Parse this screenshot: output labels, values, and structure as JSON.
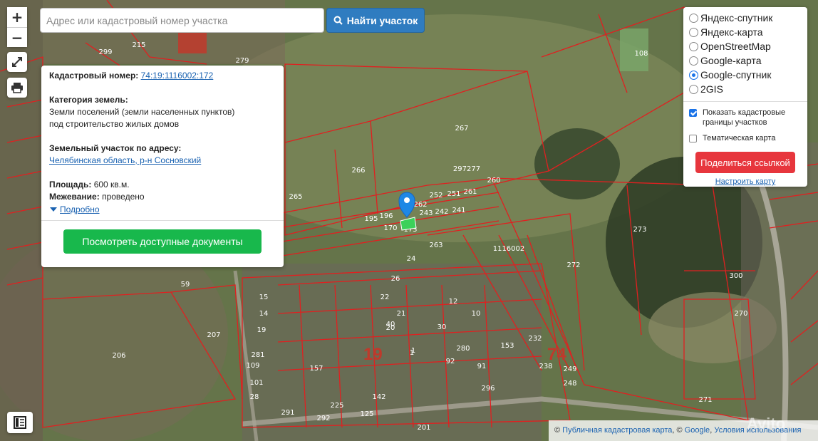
{
  "map": {
    "parcel_labels": [
      "299",
      "279",
      "215",
      "108",
      "267",
      "266",
      "265",
      "297277",
      "260",
      "261",
      "262",
      "252",
      "251",
      "196",
      "195",
      "170",
      "173",
      "243",
      "242",
      "241",
      "263",
      "1116002",
      "272",
      "273",
      "300",
      "270",
      "271",
      "59",
      "15",
      "14",
      "19",
      "1",
      "24",
      "26",
      "22",
      "21",
      "20",
      "12",
      "10",
      "30",
      "40",
      "280",
      "153",
      "91",
      "92",
      "232",
      "248",
      "249",
      "238",
      "296",
      "207",
      "206",
      "101",
      "28",
      "281",
      "109",
      "291",
      "292",
      "225",
      "142",
      "125",
      "157",
      "201",
      "1"
    ],
    "big_labels": [
      "19",
      "74"
    ]
  },
  "zoom": {
    "plus": "+",
    "minus": "−"
  },
  "controls": {
    "fullscreen_icon": "expand-arrows-icon",
    "print_icon": "printer-icon",
    "legend_icon": "map-legend-icon"
  },
  "search": {
    "placeholder": "Адрес или кадастровый номер участка",
    "value": "",
    "button_label": "Найти участок",
    "button_icon": "search-icon"
  },
  "info": {
    "cadastral_label": "Кадастровый номер:",
    "cadastral_number": "74:19:1116002:172",
    "category_label": "Категория земель:",
    "category_value_1": "Земли поселений (земли населенных пунктов)",
    "category_value_2": "под строительство жилых домов",
    "address_label": "Земельный участок по адресу:",
    "address_value": "Челябинская область, р-н Сосновский",
    "area_label": "Площадь:",
    "area_value": "600 кв.м.",
    "survey_label": "Межевание:",
    "survey_value": "проведено",
    "more_link": "Подробно",
    "docs_button": "Посмотреть доступные документы"
  },
  "layers": {
    "options": [
      {
        "label": "Яндекс-спутник",
        "checked": false
      },
      {
        "label": "Яндекс-карта",
        "checked": false
      },
      {
        "label": "OpenStreetMap",
        "checked": false
      },
      {
        "label": "Google-карта",
        "checked": false
      },
      {
        "label": "Google-спутник",
        "checked": true
      },
      {
        "label": "2GIS",
        "checked": false
      }
    ],
    "show_boundaries": "Показать кадастровые границы участков",
    "show_boundaries_checked": true,
    "thematic_map": "Тематическая карта",
    "thematic_map_checked": false,
    "share_button": "Поделиться ссылкой",
    "setup_link": "Настроить карту"
  },
  "attribution": {
    "copy": "©",
    "link1": "Публичная кадастровая карта",
    "sep": ", ©",
    "link2": "Google",
    "sep2": ",",
    "link3": "Условия использования"
  },
  "watermark": "Avito",
  "colors": {
    "parcel_line": "#e02020",
    "accent_blue": "#2f7cc0",
    "green_button": "#18b84c",
    "red_button": "#e7363d"
  }
}
